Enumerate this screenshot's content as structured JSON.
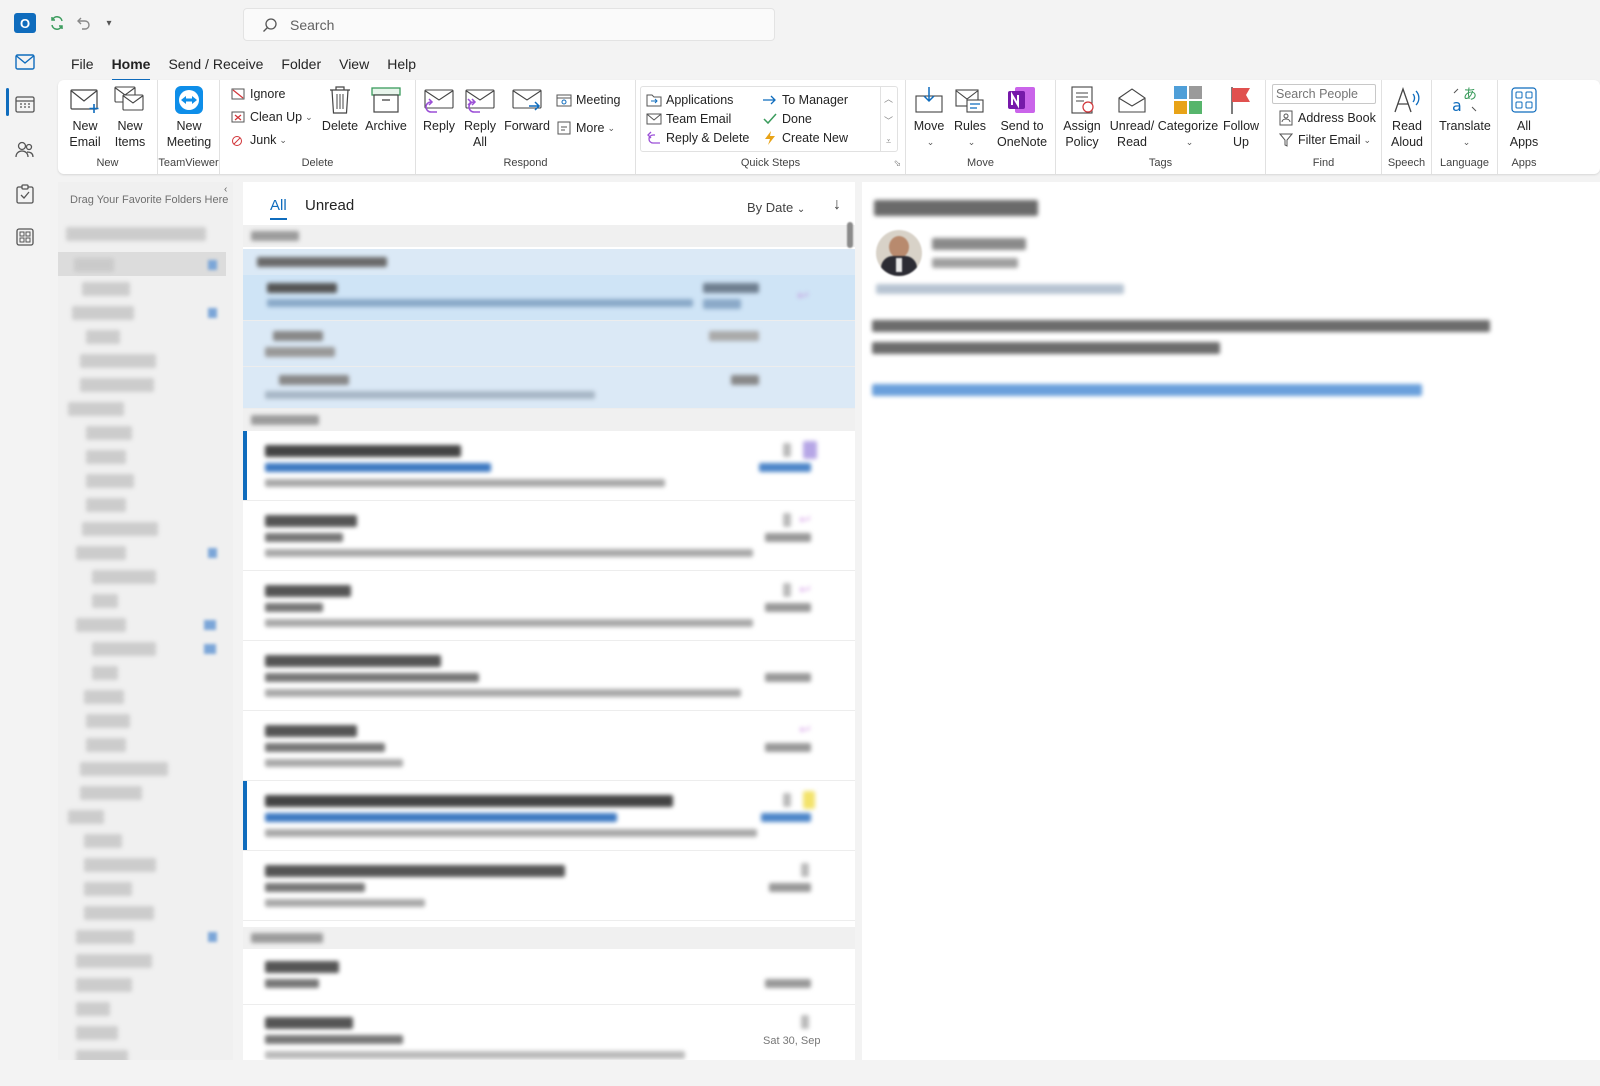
{
  "titlebar": {
    "search_placeholder": "Search"
  },
  "menu": {
    "tabs": [
      "File",
      "Home",
      "Send / Receive",
      "Folder",
      "View",
      "Help"
    ],
    "active": "Home"
  },
  "ribbon": {
    "new": {
      "new_email": "New Email",
      "new_items": "New Items",
      "label": "New"
    },
    "teamviewer": {
      "new_meeting": "New Meeting",
      "label": "TeamViewer"
    },
    "delete": {
      "ignore": "Ignore",
      "clean_up": "Clean Up",
      "junk": "Junk",
      "delete": "Delete",
      "archive": "Archive",
      "label": "Delete"
    },
    "respond": {
      "reply": "Reply",
      "reply_all": "Reply All",
      "forward": "Forward",
      "meeting": "Meeting",
      "more": "More",
      "label": "Respond"
    },
    "quick_steps": {
      "applications": "Applications",
      "team_email": "Team Email",
      "reply_delete": "Reply & Delete",
      "to_manager": "To Manager",
      "done": "Done",
      "create_new": "Create New",
      "label": "Quick Steps"
    },
    "move": {
      "move": "Move",
      "rules": "Rules",
      "send_to_onenote": "Send to OneNote",
      "label": "Move"
    },
    "tags": {
      "assign_policy": "Assign Policy",
      "unread_read": "Unread/ Read",
      "categorize": "Categorize",
      "follow_up": "Follow Up",
      "label": "Tags"
    },
    "find": {
      "search_people": "Search People",
      "address_book": "Address Book",
      "filter_email": "Filter Email",
      "label": "Find"
    },
    "speech": {
      "read_aloud": "Read Aloud",
      "label": "Speech"
    },
    "language": {
      "translate": "Translate",
      "label": "Language"
    },
    "apps": {
      "all_apps": "All Apps",
      "label": "Apps"
    }
  },
  "folder_pane": {
    "drag_hint": "Drag Your Favorite Folders Here"
  },
  "message_list": {
    "filter_all": "All",
    "filter_unread": "Unread",
    "sort_by": "By Date",
    "last_visible_date": "Sat 30, Sep"
  },
  "colors": {
    "accent": "#0f6cbd",
    "selected_row": "#cfe4f6",
    "onenote_purple": "#7719aa",
    "follow_up_red": "#d13438"
  }
}
